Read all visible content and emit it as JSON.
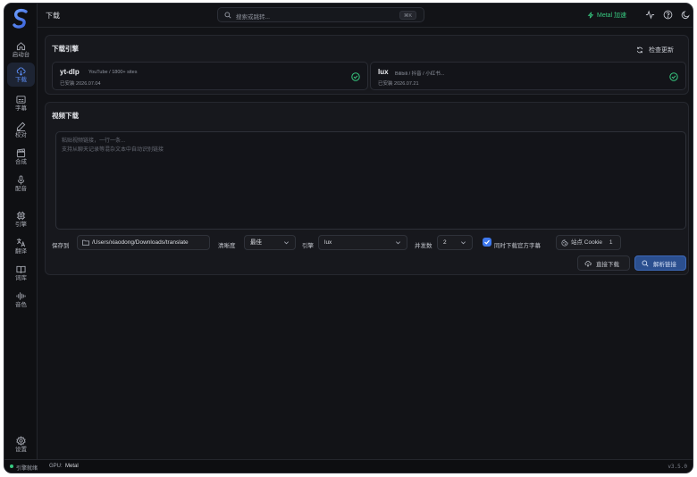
{
  "colors": {
    "accent": "#3f79ee",
    "success": "#37c980",
    "background": "#121317"
  },
  "sidebar": {
    "items": [
      {
        "label": "启动台",
        "icon": "home-icon"
      },
      {
        "label": "下载",
        "icon": "cloud-download-icon",
        "active": true
      },
      {
        "label": "字幕",
        "icon": "subtitles-icon"
      },
      {
        "label": "校对",
        "icon": "pen-icon"
      },
      {
        "label": "合成",
        "icon": "clapperboard-icon"
      },
      {
        "label": "配音",
        "icon": "microphone-icon"
      },
      {
        "label": "引擎",
        "icon": "chip-icon"
      },
      {
        "label": "翻译",
        "icon": "translate-icon"
      },
      {
        "label": "词库",
        "icon": "book-icon"
      },
      {
        "label": "音色",
        "icon": "waveform-icon"
      }
    ],
    "settings_label": "设置"
  },
  "header": {
    "title": "下载",
    "search_placeholder": "搜索或跳转...",
    "search_shortcut": "⌘K",
    "metal_label": "Metal 加速"
  },
  "engines_card": {
    "title": "下载引擎",
    "check_update": "检查更新",
    "engines": [
      {
        "name": "yt-dlp",
        "desc": "YouTube / 1800+ sites",
        "installed": "已安装 2026.07.04"
      },
      {
        "name": "lux",
        "desc": "Bilibili / 抖音 / 小红书...",
        "installed": "已安装 2026.07.21"
      }
    ]
  },
  "download_card": {
    "title": "视频下载",
    "textarea_placeholder": "粘贴视频链接，一行一条...\n支持从聊天记录等混杂文本中自动识别链接",
    "save_to_label": "保存到",
    "save_path": "/Users/xiaodong/Downloads/translate",
    "quality_label": "清晰度",
    "quality_value": "最佳",
    "engine_label": "引擎",
    "engine_value": "lux",
    "concurrency_label": "并发数",
    "concurrency_value": "2",
    "subs_checkbox_label": "同时下载官方字幕",
    "subs_checked": true,
    "cookie_label": "站点 Cookie",
    "cookie_count": "1",
    "direct_download": "直接下载",
    "parse_links": "解析链接"
  },
  "statusbar": {
    "engine_status": "引擎就绪",
    "gpu_label": "GPU:",
    "gpu_value": "Metal",
    "version": "v3.5.0"
  }
}
